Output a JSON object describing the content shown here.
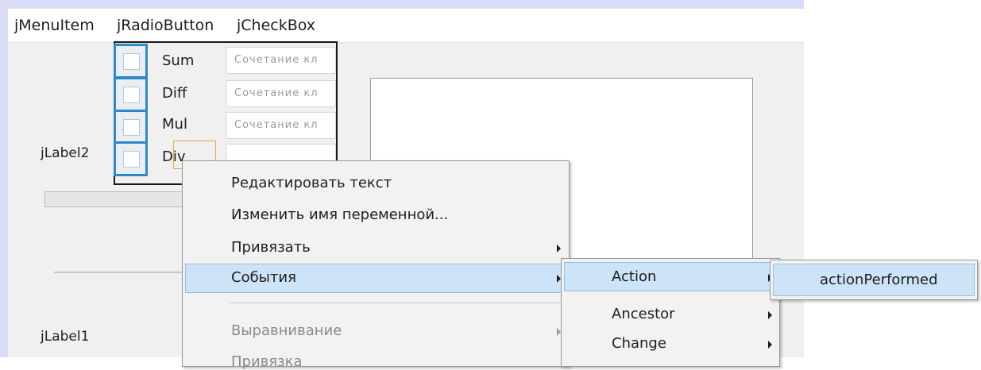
{
  "menubar": {
    "items": [
      "jMenuItem",
      "jRadioButton",
      "jCheckBox"
    ]
  },
  "checkboxes": [
    {
      "label": "Sum",
      "field_placeholder": "Сочетание кл"
    },
    {
      "label": "Diff",
      "field_placeholder": "Сочетание кл"
    },
    {
      "label": "Mul",
      "field_placeholder": "Сочетание кл"
    },
    {
      "label": "Div",
      "field_placeholder": ""
    }
  ],
  "labels": {
    "label2": "jLabel2",
    "label1": "jLabel1"
  },
  "context_menu": {
    "items": [
      {
        "label": "Редактировать текст"
      },
      {
        "label": "Изменить имя переменной..."
      },
      {
        "label": "Привязать",
        "submenu": true
      },
      {
        "label": "События",
        "submenu": true,
        "highlighted": true
      },
      {
        "label": "Выравнивание",
        "submenu": true,
        "disabled": true
      },
      {
        "label": "Привязка",
        "submenu": true,
        "disabled": true
      }
    ]
  },
  "events_submenu": {
    "items": [
      {
        "label": "Action",
        "submenu": true,
        "highlighted": true
      },
      {
        "label": "Ancestor",
        "submenu": true
      },
      {
        "label": "Change",
        "submenu": true
      }
    ]
  },
  "action_submenu": {
    "items": [
      {
        "label": "actionPerformed"
      }
    ]
  },
  "colors": {
    "highlight": "#cde3f7",
    "highlight_border": "#98bce6",
    "checkbox_border": "#2d8ac7",
    "selection_orange": "#f1a43a",
    "frame": "#d9dcf6"
  }
}
